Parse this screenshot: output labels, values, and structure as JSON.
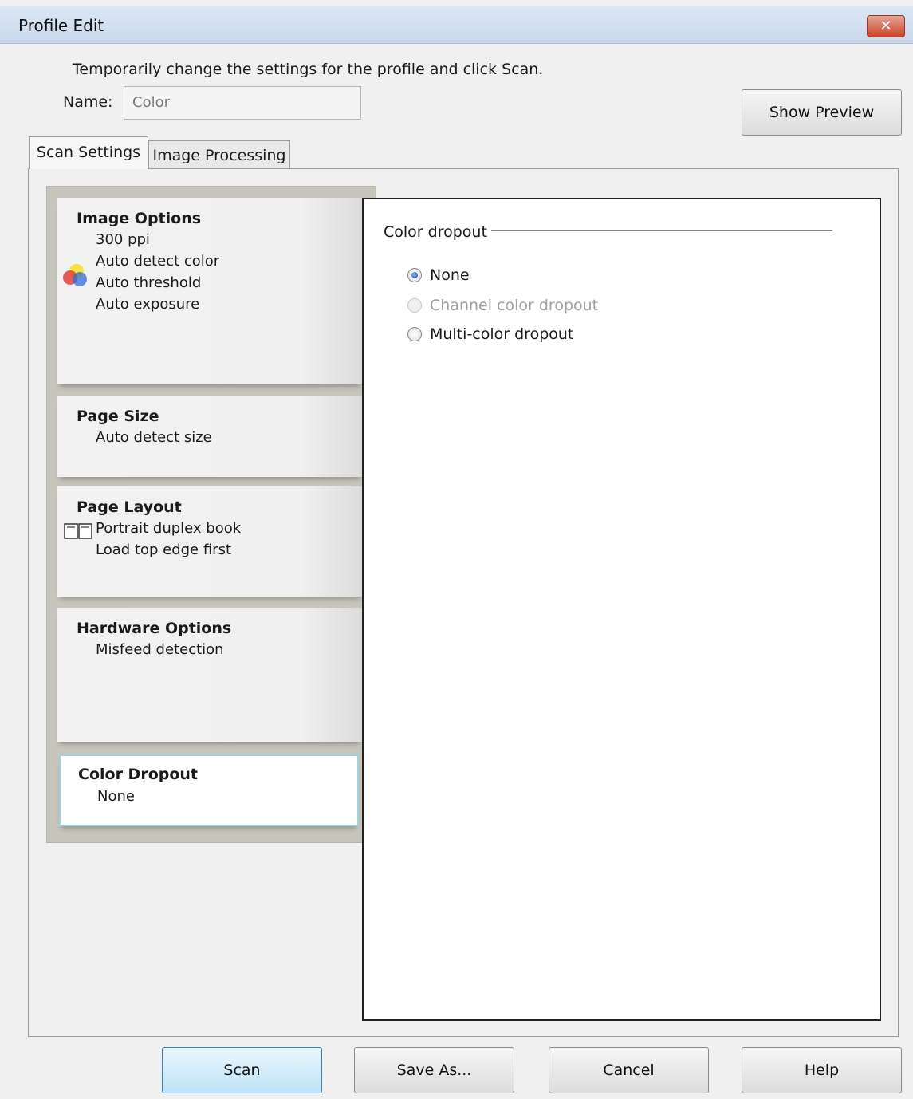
{
  "window": {
    "title": "Profile Edit",
    "close_label": "✕"
  },
  "header": {
    "instruction": "Temporarily change the settings for the profile and click Scan.",
    "name_label": "Name:",
    "name_value": "Color",
    "show_preview_label": "Show Preview"
  },
  "tabs": [
    {
      "label": "Scan Settings",
      "active": true
    },
    {
      "label": "Image Processing",
      "active": false
    }
  ],
  "settings_cards": [
    {
      "title": "Image Options",
      "lines": [
        "300 ppi",
        "Auto detect color",
        "Auto threshold",
        "Auto exposure"
      ],
      "icon": "color-circles-icon"
    },
    {
      "title": "Page Size",
      "lines": [
        "Auto detect size"
      ]
    },
    {
      "title": "Page Layout",
      "lines": [
        "Portrait duplex book",
        "Load top edge first"
      ],
      "icon": "book-layout-icon"
    },
    {
      "title": "Hardware Options",
      "lines": [
        "Misfeed detection"
      ]
    },
    {
      "title": "Color Dropout",
      "lines": [
        "None"
      ],
      "selected": true
    }
  ],
  "color_dropout": {
    "group_label": "Color dropout",
    "options": [
      {
        "label": "None",
        "checked": true,
        "enabled": true
      },
      {
        "label": "Channel color dropout",
        "checked": false,
        "enabled": false
      },
      {
        "label": "Multi-color dropout",
        "checked": false,
        "enabled": true
      }
    ]
  },
  "footer": {
    "scan_label": "Scan",
    "save_as_label": "Save As...",
    "cancel_label": "Cancel",
    "help_label": "Help"
  },
  "colors": {
    "accent": "#3c7fb1",
    "selected_border": "#9ed3dc",
    "close": "#c9432a"
  }
}
